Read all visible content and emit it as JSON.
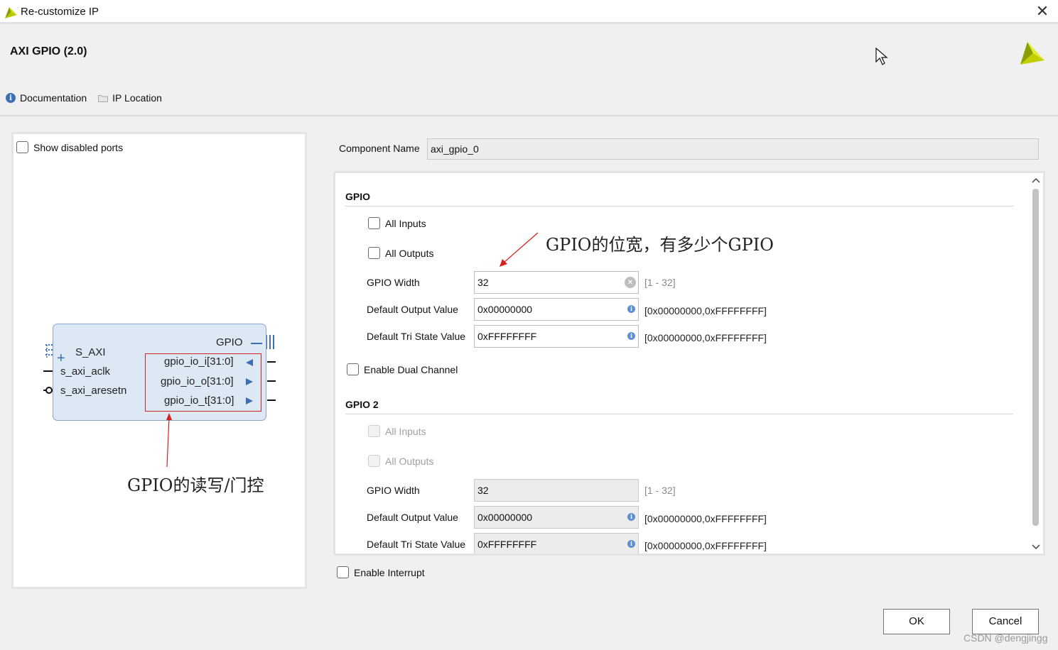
{
  "window": {
    "title": "Re-customize IP",
    "close_glyph": "✕"
  },
  "ip": {
    "name": "AXI GPIO (2.0)"
  },
  "links": {
    "documentation": "Documentation",
    "ip_location": "IP Location"
  },
  "left_panel": {
    "show_disabled_ports": "Show disabled ports",
    "block": {
      "bus_label": "GPIO",
      "s_axi": "S_AXI",
      "aclk": "s_axi_aclk",
      "aresetn": "s_axi_aresetn",
      "ports": [
        "gpio_io_i[31:0]",
        "gpio_io_o[31:0]",
        "gpio_io_t[31:0]"
      ]
    },
    "annotation": "GPIO的读写/门控"
  },
  "component": {
    "label": "Component Name",
    "value": "axi_gpio_0"
  },
  "gpio1": {
    "title": "GPIO",
    "all_inputs": "All Inputs",
    "all_outputs": "All Outputs",
    "width_label": "GPIO Width",
    "width_value": "32",
    "width_range": "[1 - 32]",
    "default_output_label": "Default Output Value",
    "default_output_value": "0x00000000",
    "default_output_range": "[0x00000000,0xFFFFFFFF]",
    "tri_state_label": "Default Tri State Value",
    "tri_state_value": "0xFFFFFFFF",
    "tri_state_range": "[0x00000000,0xFFFFFFFF]",
    "annotation": "GPIO的位宽，有多少个GPIO"
  },
  "dual_channel": "Enable Dual Channel",
  "gpio2": {
    "title": "GPIO 2",
    "all_inputs": "All Inputs",
    "all_outputs": "All Outputs",
    "width_label": "GPIO Width",
    "width_value": "32",
    "width_range": "[1 - 32]",
    "default_output_label": "Default Output Value",
    "default_output_value": "0x00000000",
    "default_output_range": "[0x00000000,0xFFFFFFFF]",
    "tri_state_label": "Default Tri State Value",
    "tri_state_value": "0xFFFFFFFF",
    "tri_state_range": "[0x00000000,0xFFFFFFFF]"
  },
  "enable_interrupt": "Enable Interrupt",
  "buttons": {
    "ok": "OK",
    "cancel": "Cancel"
  },
  "watermark": "CSDN @dengjingg",
  "icons": {
    "app_logo": "xilinx-logo-icon",
    "documentation": "info-icon",
    "ip_location": "folder-icon",
    "clear": "clear-icon",
    "info": "info-icon",
    "scroll_up": "chevron-up-icon",
    "scroll_down": "chevron-down-icon"
  },
  "colors": {
    "accent": "#3d6fb3",
    "annotation": "#d42020",
    "brand": "#c8d400",
    "ip_block_fill": "#dde8f5"
  }
}
